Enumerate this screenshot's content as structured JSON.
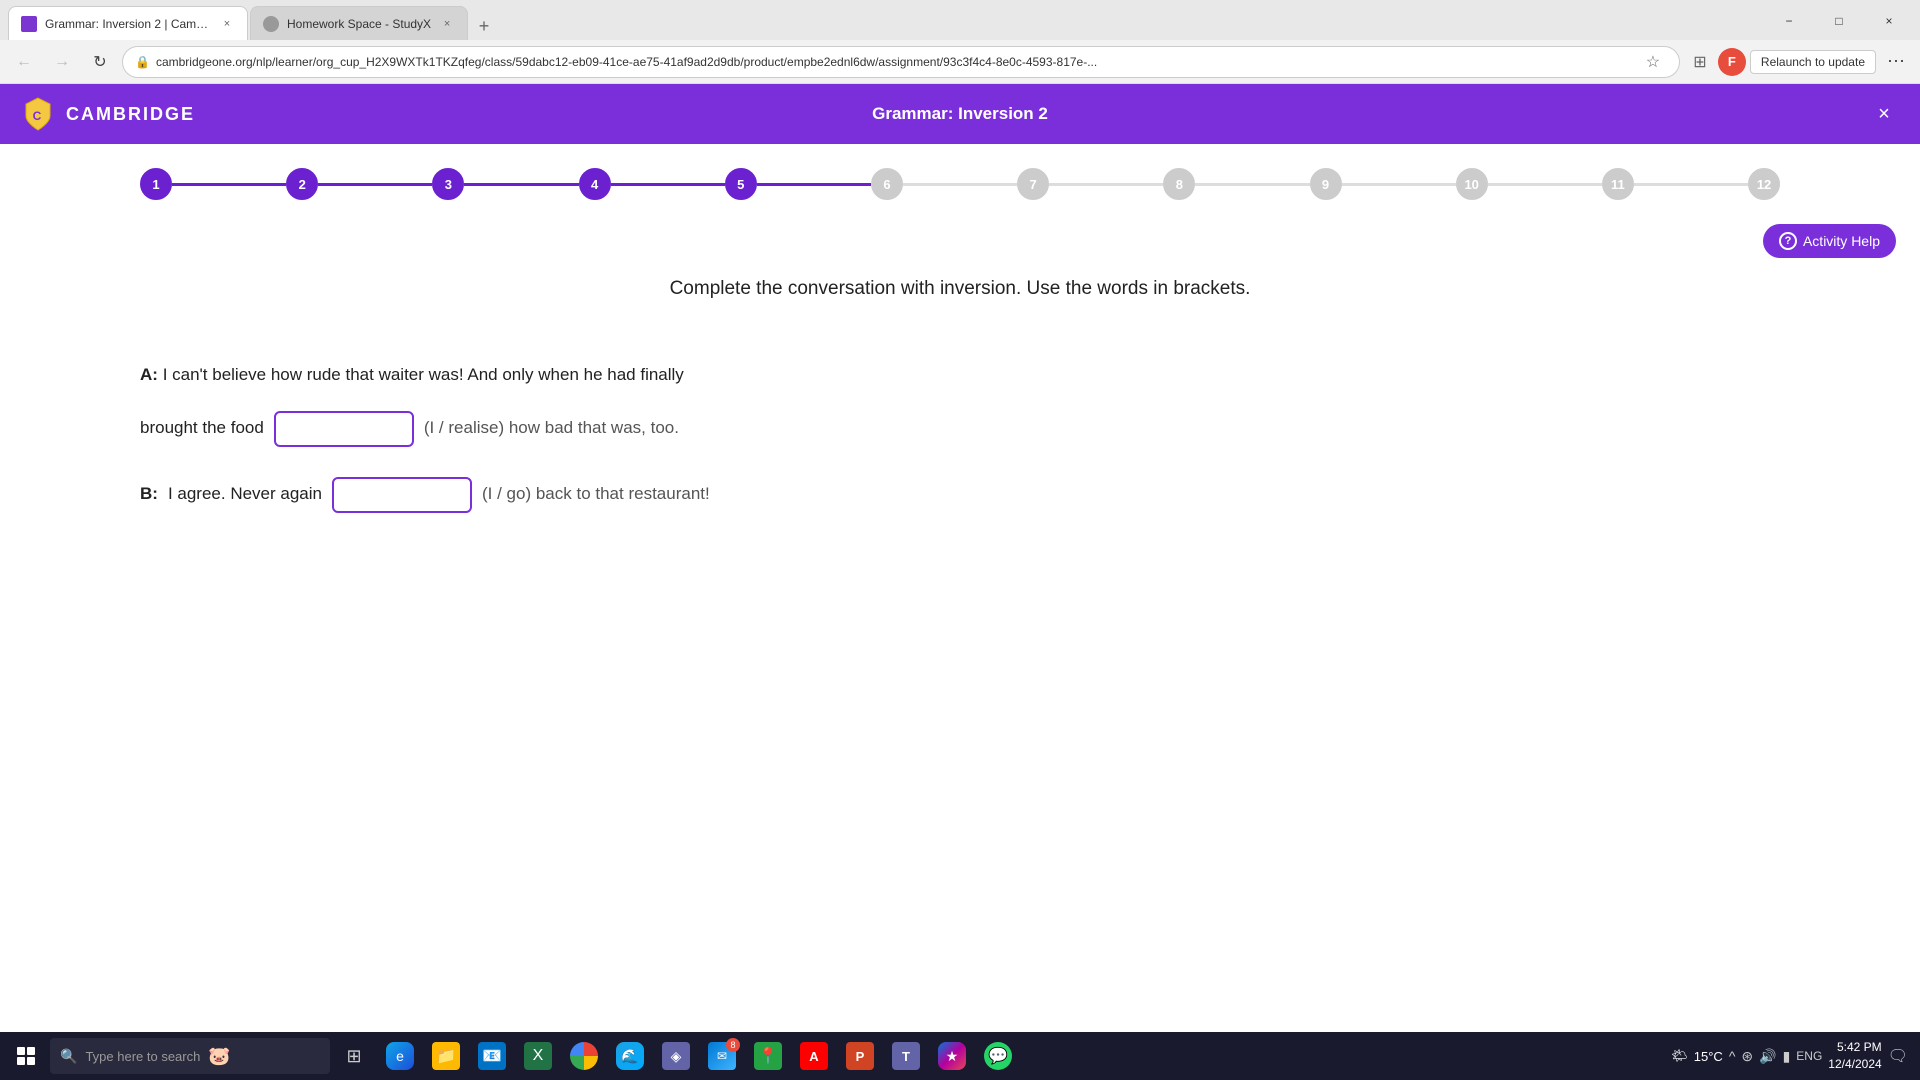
{
  "browser": {
    "tabs": [
      {
        "id": "tab1",
        "title": "Grammar: Inversion 2 | Cambri...",
        "favicon_color": "#7b2fdb",
        "active": true
      },
      {
        "id": "tab2",
        "title": "Homework Space - StudyX",
        "favicon_color": "#999",
        "active": false
      }
    ],
    "url": "cambridgeone.org/nlp/learner/org_cup_H2X9WXTk1TKZqfeg/class/59dabc12-eb09-41ce-ae75-41af9ad2d9db/product/empbe2ednl6dw/assignment/93c3f4c4-8e0c-4593-817e-...",
    "relaunch_label": "Relaunch to update",
    "window_controls": {
      "minimize": "−",
      "maximize": "□",
      "close": "×"
    }
  },
  "header": {
    "brand": "CAMBRIDGE",
    "title": "Grammar: Inversion 2",
    "close_label": "×"
  },
  "progress": {
    "steps": [
      {
        "number": "1",
        "active": true
      },
      {
        "number": "2",
        "active": true
      },
      {
        "number": "3",
        "active": true
      },
      {
        "number": "4",
        "active": true
      },
      {
        "number": "5",
        "active": true
      },
      {
        "number": "6",
        "active": false
      },
      {
        "number": "7",
        "active": false
      },
      {
        "number": "8",
        "active": false
      },
      {
        "number": "9",
        "active": false
      },
      {
        "number": "10",
        "active": false
      },
      {
        "number": "11",
        "active": false
      },
      {
        "number": "12",
        "active": false
      }
    ]
  },
  "activity_help": {
    "label": "Activity Help"
  },
  "exercise": {
    "instruction": "Complete the conversation with inversion. Use the words in brackets.",
    "dialogue": [
      {
        "speaker": "A:",
        "text_before": "I can't believe how rude that waiter was! And only when he had finally",
        "line2_before": "brought the food",
        "hint1": "(I / realise) how bad that was, too.",
        "input1_value": "",
        "has_line2": true,
        "line2_hint": ""
      },
      {
        "speaker": "B:",
        "text_before": "I agree. Never again",
        "hint1": "(I / go) back to that restaurant!",
        "input1_value": "",
        "has_line2": false
      }
    ]
  },
  "taskbar": {
    "search_placeholder": "Type here to search",
    "apps": [
      {
        "name": "files",
        "icon": "📁",
        "css_class": "icon-file"
      },
      {
        "name": "edge",
        "icon": "🌐",
        "css_class": "icon-edge2"
      },
      {
        "name": "outlook",
        "icon": "📧",
        "css_class": "icon-outlook"
      },
      {
        "name": "excel",
        "icon": "📊",
        "css_class": "icon-excel"
      },
      {
        "name": "chrome",
        "icon": "◉",
        "css_class": "icon-chrome"
      },
      {
        "name": "edge-browser",
        "icon": "🌊",
        "css_class": "icon-edge"
      },
      {
        "name": "unknown1",
        "icon": "◈",
        "css_class": ""
      },
      {
        "name": "mail",
        "icon": "✉",
        "css_class": "icon-mail"
      },
      {
        "name": "maps",
        "icon": "◆",
        "css_class": "icon-maps"
      },
      {
        "name": "adobe",
        "icon": "A",
        "css_class": "icon-adobe"
      },
      {
        "name": "ppt",
        "icon": "P",
        "css_class": "icon-ppt"
      },
      {
        "name": "teams",
        "icon": "T",
        "css_class": "icon-teams"
      },
      {
        "name": "photos",
        "icon": "★",
        "css_class": "icon-photos"
      },
      {
        "name": "whatsapp",
        "icon": "W",
        "css_class": "icon-whatsapp"
      }
    ],
    "system_tray": {
      "temperature": "15°C",
      "language": "ENG",
      "time": "5:42 PM",
      "date": "12/4/2024"
    }
  }
}
